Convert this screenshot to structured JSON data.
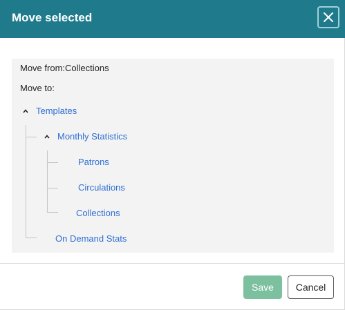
{
  "dialog": {
    "title": "Move selected",
    "close_icon": "close-icon"
  },
  "panel": {
    "move_from": "Move from:Collections",
    "move_to": "Move to:"
  },
  "tree": {
    "templates": "Templates",
    "monthly_statistics": "Monthly Statistics",
    "patrons": "Patrons",
    "circulations": "Circulations",
    "collections": "Collections",
    "on_demand_stats": "On Demand Stats",
    "expanded_icon": "chevron-up-icon"
  },
  "footer": {
    "save_label": "Save",
    "cancel_label": "Cancel"
  },
  "colors": {
    "header": "#1f7a8c",
    "link": "#2e6fd2",
    "save_button": "#7cc09f",
    "panel_bg": "#f3f3f3"
  }
}
